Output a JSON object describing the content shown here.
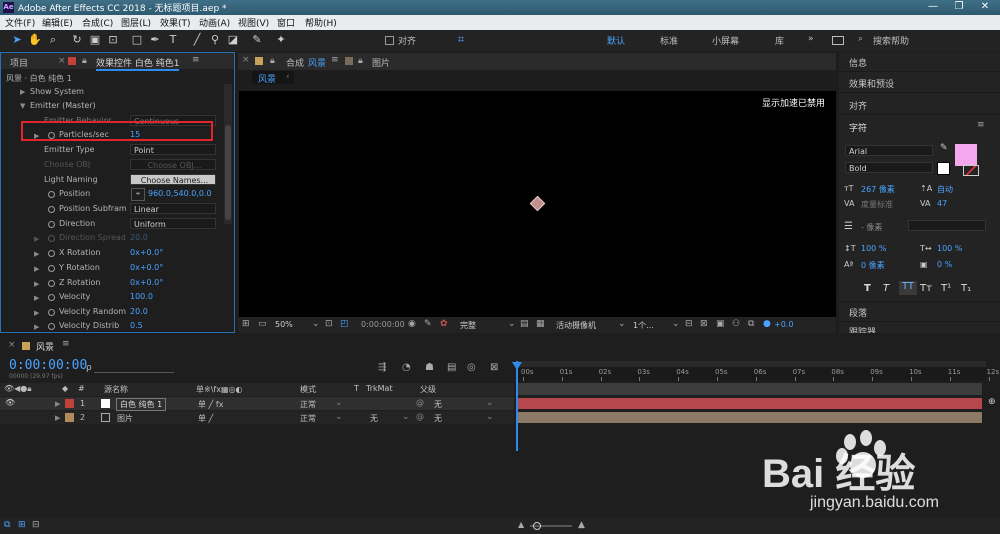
{
  "app": {
    "title": "Adobe After Effects CC 2018 - 无标题项目.aep *",
    "icon_text": "Ae",
    "window_buttons": [
      "—",
      "❐",
      "✕"
    ]
  },
  "menu": [
    "文件(F)",
    "编辑(E)",
    "合成(C)",
    "图层(L)",
    "效果(T)",
    "动画(A)",
    "视图(V)",
    "窗口",
    "帮助(H)"
  ],
  "toolbar": {
    "align_label": "对齐",
    "workspaces": [
      "默认",
      "标准",
      "小屏幕",
      "库"
    ],
    "search_placeholder": "搜索帮助"
  },
  "left_panel": {
    "tab_project": "项目",
    "tab_effects": "效果控件 白色 纯色1",
    "breadcrumb": "风景 · 白色 纯色 1",
    "rows": [
      {
        "label": "Show System",
        "value": ""
      },
      {
        "label": "Emitter (Master)",
        "value": ""
      },
      {
        "label": "Emitter Behavior",
        "value": "Continuous"
      },
      {
        "label": "Particles/sec",
        "value": "15"
      },
      {
        "label": "Emitter Type",
        "value": "Point"
      },
      {
        "label": "Choose OBJ",
        "value": "Choose OBJ..."
      },
      {
        "label": "Light Naming",
        "value": "Choose Names..."
      },
      {
        "label": "Position",
        "value": "960.0,540.0,0.0"
      },
      {
        "label": "Position Subfram",
        "value": "Linear"
      },
      {
        "label": "Direction",
        "value": "Uniform"
      },
      {
        "label": "Direction Spread",
        "value": "20.0"
      },
      {
        "label": "X Rotation",
        "value": "0x+0.0°"
      },
      {
        "label": "Y Rotation",
        "value": "0x+0.0°"
      },
      {
        "label": "Z Rotation",
        "value": "0x+0.0°"
      },
      {
        "label": "Velocity",
        "value": "100.0"
      },
      {
        "label": "Velocity Random",
        "value": "20.0"
      },
      {
        "label": "Velocity Distrib",
        "value": "0.5"
      }
    ]
  },
  "comp_panel": {
    "tab_label": "合成",
    "comp_name": "风景",
    "tab_footage": "图片",
    "sub_tab": "风景",
    "accel_msg": "显示加速已禁用",
    "zoom": "50%",
    "timecode": "0:00:00:00",
    "quality": "完整",
    "camera": "活动摄像机",
    "views": "1个...",
    "exposure": "+0.0"
  },
  "right_panel": {
    "items": [
      "信息",
      "效果和预设",
      "对齐"
    ],
    "char_title": "字符",
    "font_name": "Arial",
    "font_style": "Bold",
    "font_size": "267 像素",
    "leading": "自动",
    "kerning": "度量标准",
    "tracking": "47",
    "stroke_width": "- 像素",
    "vscale": "100 %",
    "hscale": "100 %",
    "baseline": "0 像素",
    "tsume": "0 %",
    "style_buttons": [
      "T",
      "T",
      "TT",
      "Tт",
      "T¹",
      "T₁"
    ],
    "para_title": "段落",
    "tracker_title": "跟踪器",
    "swatch_color": "#f5a7ee"
  },
  "timeline": {
    "comp_name": "风景",
    "timecode": "0:00:00:00",
    "frame_info": "00000 (29.97 fps)",
    "search_placeholder": "ρ",
    "columns": {
      "num": "#",
      "source": "源名称",
      "switches": "单※\\fx▦◎◐",
      "mode": "模式",
      "t": "T",
      "trkmat": "TrkMat",
      "parent": "父级"
    },
    "ruler": [
      "00s",
      "01s",
      "02s",
      "03s",
      "04s",
      "05s",
      "06s",
      "07s",
      "08s",
      "09s",
      "10s",
      "11s",
      "12s"
    ],
    "layers": [
      {
        "index": "1",
        "name": "白色 纯色 1",
        "label_color": "#c2413b",
        "mode": "正常",
        "trkmat": "",
        "parent": "无",
        "bar_color": "#b5474d"
      },
      {
        "index": "2",
        "name": "图片",
        "label_color": "#b08a5c",
        "mode": "正常",
        "trkmat": "无",
        "parent": "无",
        "bar_color": "#8c7a66"
      }
    ]
  },
  "watermark": {
    "logo": "Bai 经验",
    "url": "jingyan.baidu.com"
  },
  "colors": {
    "accent": "#2d8ceb",
    "highlight_box": "#e0262b",
    "titlebar": "#336278"
  }
}
